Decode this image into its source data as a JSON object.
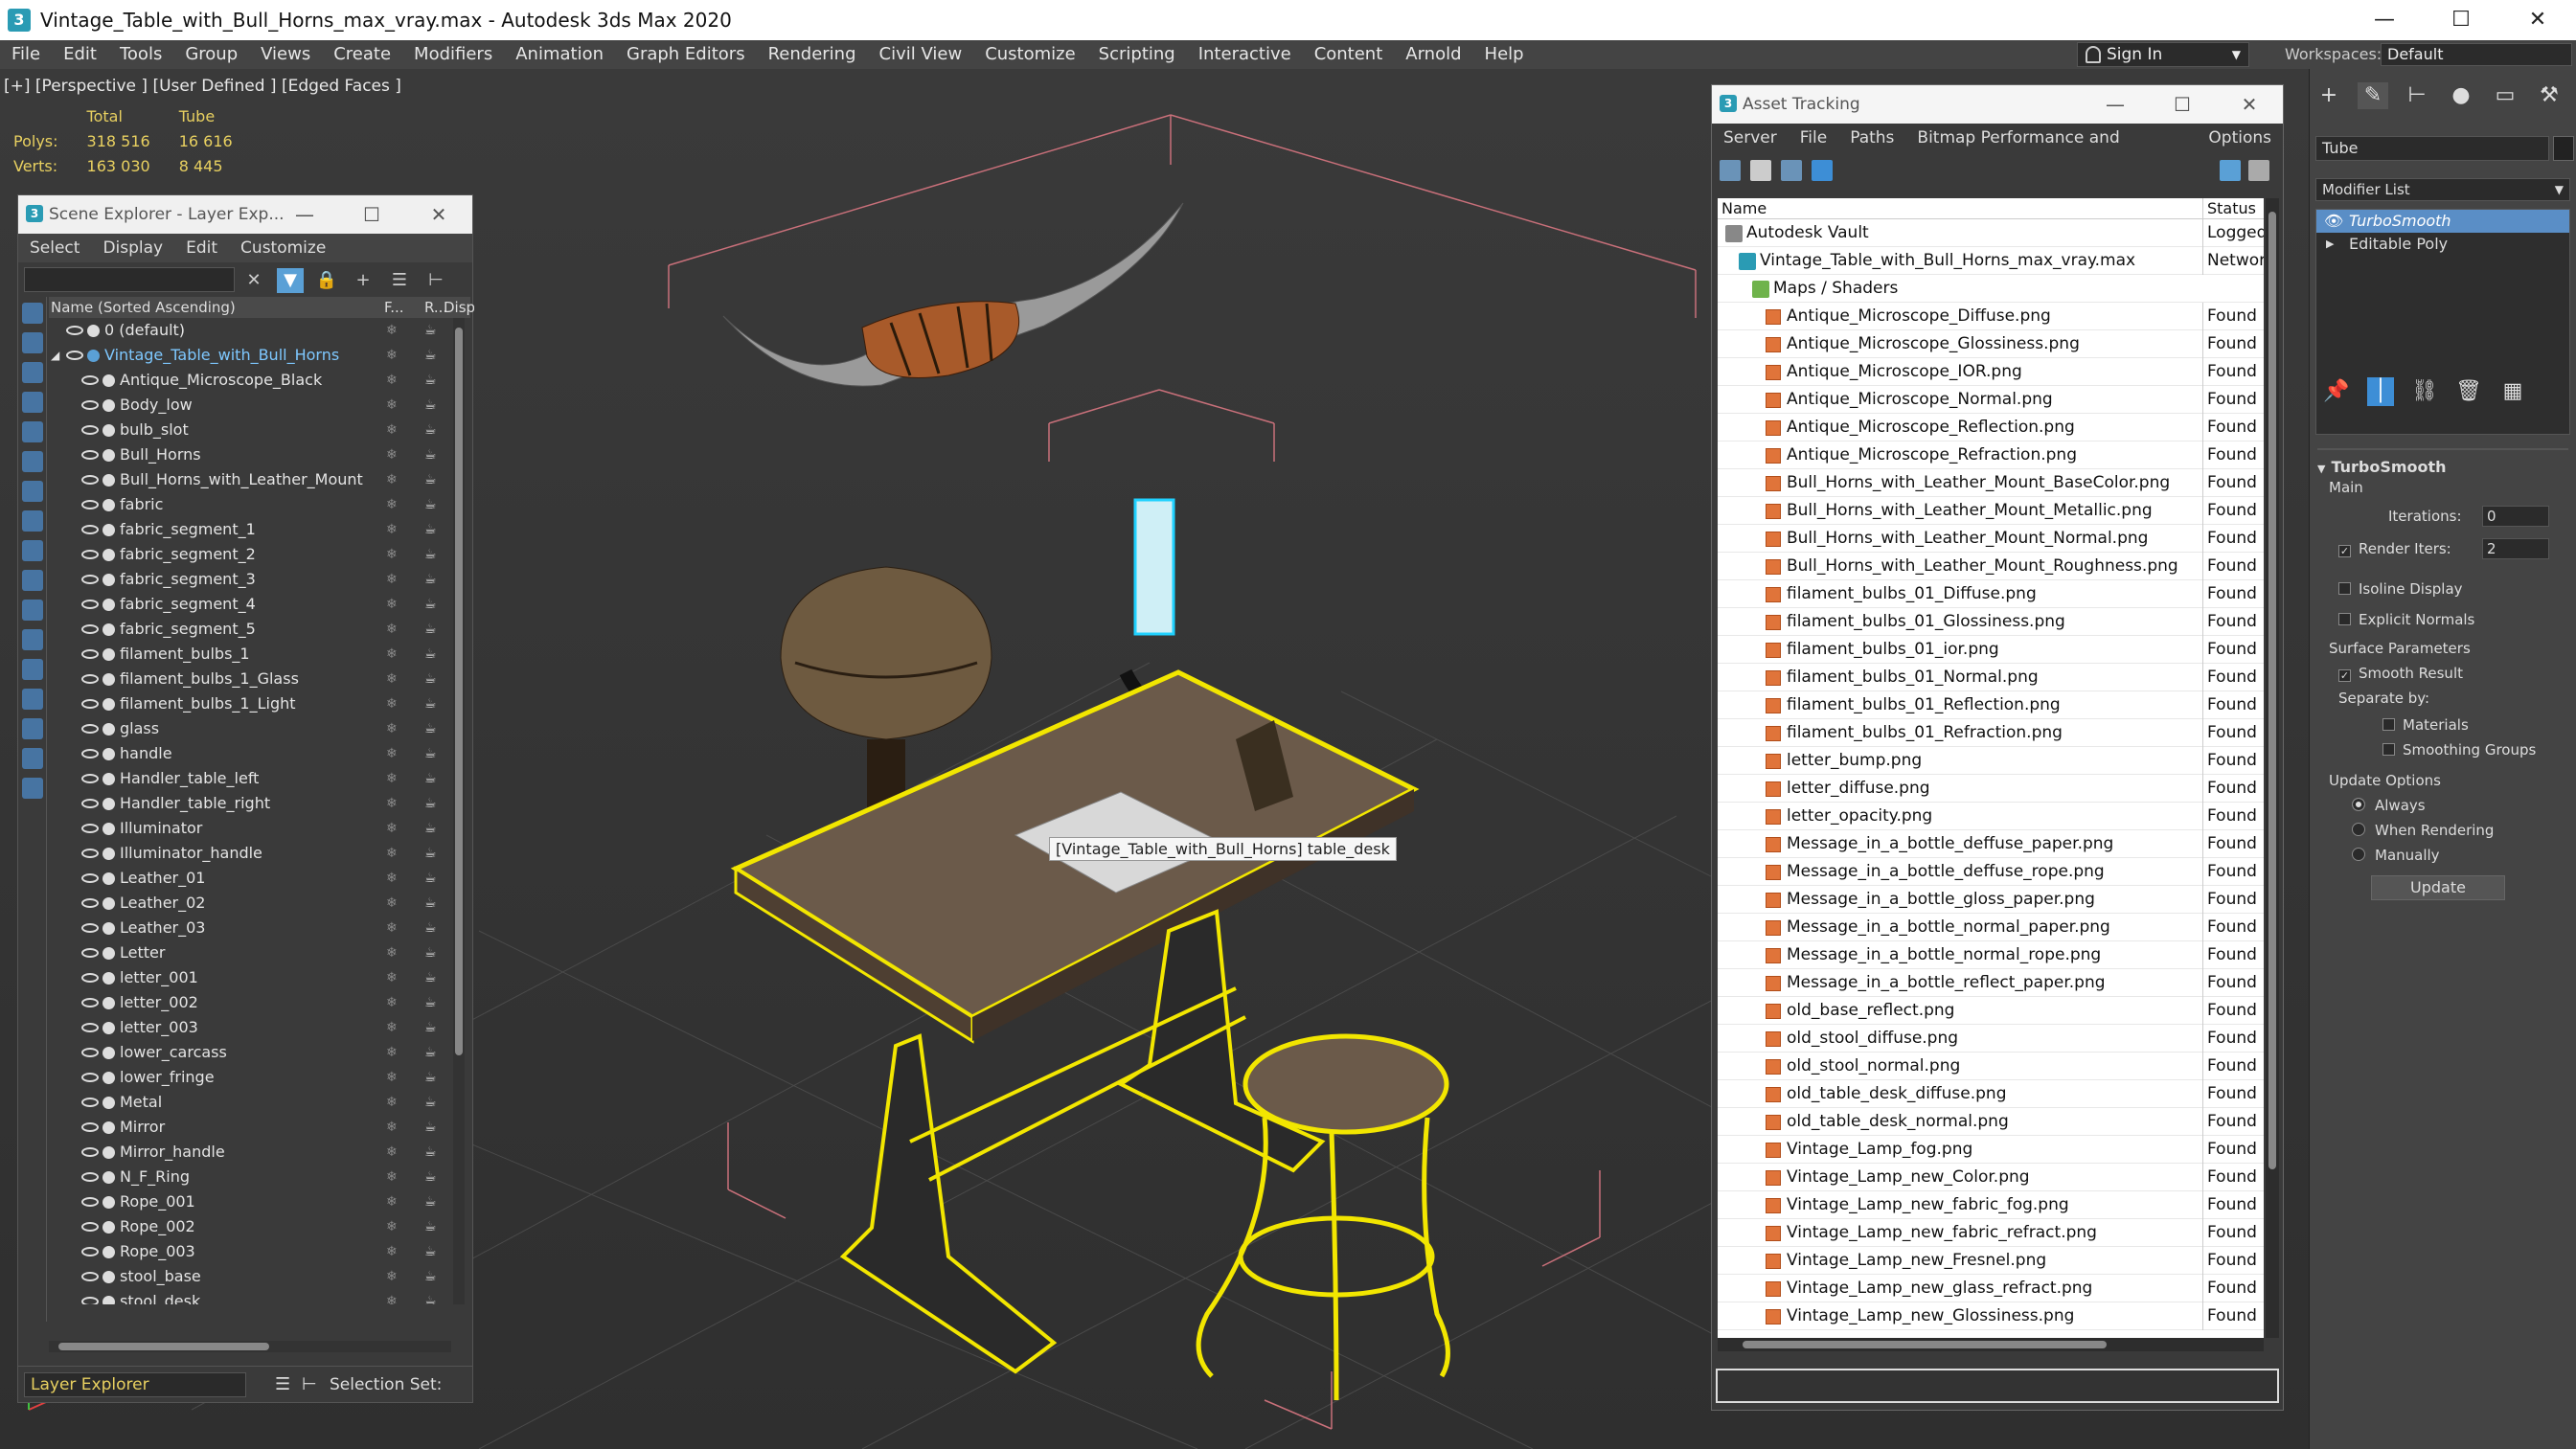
{
  "window": {
    "title": "Vintage_Table_with_Bull_Horns_max_vray.max - Autodesk 3ds Max 2020",
    "app_icon": "3"
  },
  "menu": [
    "File",
    "Edit",
    "Tools",
    "Group",
    "Views",
    "Create",
    "Modifiers",
    "Animation",
    "Graph Editors",
    "Rendering",
    "Civil View",
    "Customize",
    "Scripting",
    "Interactive",
    "Content",
    "Arnold",
    "Help"
  ],
  "account": {
    "sign_in": "Sign In",
    "workspaces_label": "Workspaces:",
    "workspace": "Default"
  },
  "viewport": {
    "label": "[+] [Perspective ] [User Defined ] [Edged Faces ]",
    "stats": {
      "col_total": "Total",
      "col_tube": "Tube",
      "polys_label": "Polys:",
      "polys_total": "318 516",
      "polys_tube": "16 616",
      "verts_label": "Verts:",
      "verts_total": "163 030",
      "verts_tube": "8 445"
    },
    "tooltip": "[Vintage_Table_with_Bull_Horns] table_desk"
  },
  "scene_explorer": {
    "title": "Scene Explorer - Layer Exp...",
    "menu": [
      "Select",
      "Display",
      "Edit",
      "Customize"
    ],
    "columns": {
      "name": "Name (Sorted Ascending)",
      "f": "F...",
      "r": "R...",
      "d": "Displa"
    },
    "rows": [
      {
        "name": "0 (default)",
        "level": 0
      },
      {
        "name": "Vintage_Table_with_Bull_Horns",
        "level": 0,
        "selected": true
      },
      {
        "name": "Antique_Microscope_Black",
        "level": 1
      },
      {
        "name": "Body_low",
        "level": 1
      },
      {
        "name": "bulb_slot",
        "level": 1
      },
      {
        "name": "Bull_Horns",
        "level": 1
      },
      {
        "name": "Bull_Horns_with_Leather_Mount",
        "level": 1
      },
      {
        "name": "fabric",
        "level": 1
      },
      {
        "name": "fabric_segment_1",
        "level": 1
      },
      {
        "name": "fabric_segment_2",
        "level": 1
      },
      {
        "name": "fabric_segment_3",
        "level": 1
      },
      {
        "name": "fabric_segment_4",
        "level": 1
      },
      {
        "name": "fabric_segment_5",
        "level": 1
      },
      {
        "name": "filament_bulbs_1",
        "level": 1
      },
      {
        "name": "filament_bulbs_1_Glass",
        "level": 1
      },
      {
        "name": "filament_bulbs_1_Light",
        "level": 1
      },
      {
        "name": "glass",
        "level": 1
      },
      {
        "name": "handle",
        "level": 1
      },
      {
        "name": "Handler_table_left",
        "level": 1
      },
      {
        "name": "Handler_table_right",
        "level": 1
      },
      {
        "name": "Illuminator",
        "level": 1
      },
      {
        "name": "Illuminator_handle",
        "level": 1
      },
      {
        "name": "Leather_01",
        "level": 1
      },
      {
        "name": "Leather_02",
        "level": 1
      },
      {
        "name": "Leather_03",
        "level": 1
      },
      {
        "name": "Letter",
        "level": 1
      },
      {
        "name": "letter_001",
        "level": 1
      },
      {
        "name": "letter_002",
        "level": 1
      },
      {
        "name": "letter_003",
        "level": 1
      },
      {
        "name": "lower_carcass",
        "level": 1
      },
      {
        "name": "lower_fringe",
        "level": 1
      },
      {
        "name": "Metal",
        "level": 1
      },
      {
        "name": "Mirror",
        "level": 1
      },
      {
        "name": "Mirror_handle",
        "level": 1
      },
      {
        "name": "N_F_Ring",
        "level": 1
      },
      {
        "name": "Rope_001",
        "level": 1
      },
      {
        "name": "Rope_002",
        "level": 1
      },
      {
        "name": "Rope_003",
        "level": 1
      },
      {
        "name": "stool_base",
        "level": 1
      },
      {
        "name": "stool_desk",
        "level": 1
      }
    ],
    "footer": {
      "layer_explorer": "Layer Explorer",
      "selection_set": "Selection Set:"
    }
  },
  "asset_tracking": {
    "title": "Asset Tracking",
    "menu": [
      "Server",
      "File",
      "Paths",
      "Bitmap Performance and Memory",
      "Options"
    ],
    "columns": {
      "name": "Name",
      "status": "Status"
    },
    "rows": [
      {
        "name": "Autodesk Vault",
        "status": "Logged",
        "kind": "vault",
        "indent": 0
      },
      {
        "name": "Vintage_Table_with_Bull_Horns_max_vray.max",
        "status": "Networ",
        "kind": "max",
        "indent": 1
      },
      {
        "name": "Maps / Shaders",
        "status": "",
        "kind": "folder",
        "indent": 2
      },
      {
        "name": "Antique_Microscope_Diffuse.png",
        "status": "Found",
        "kind": "file",
        "indent": 3
      },
      {
        "name": "Antique_Microscope_Glossiness.png",
        "status": "Found",
        "kind": "file",
        "indent": 3
      },
      {
        "name": "Antique_Microscope_IOR.png",
        "status": "Found",
        "kind": "file",
        "indent": 3
      },
      {
        "name": "Antique_Microscope_Normal.png",
        "status": "Found",
        "kind": "file",
        "indent": 3
      },
      {
        "name": "Antique_Microscope_Reflection.png",
        "status": "Found",
        "kind": "file",
        "indent": 3
      },
      {
        "name": "Antique_Microscope_Refraction.png",
        "status": "Found",
        "kind": "file",
        "indent": 3
      },
      {
        "name": "Bull_Horns_with_Leather_Mount_BaseColor.png",
        "status": "Found",
        "kind": "file",
        "indent": 3
      },
      {
        "name": "Bull_Horns_with_Leather_Mount_Metallic.png",
        "status": "Found",
        "kind": "file",
        "indent": 3
      },
      {
        "name": "Bull_Horns_with_Leather_Mount_Normal.png",
        "status": "Found",
        "kind": "file",
        "indent": 3
      },
      {
        "name": "Bull_Horns_with_Leather_Mount_Roughness.png",
        "status": "Found",
        "kind": "file",
        "indent": 3
      },
      {
        "name": "filament_bulbs_01_Diffuse.png",
        "status": "Found",
        "kind": "file",
        "indent": 3
      },
      {
        "name": "filament_bulbs_01_Glossiness.png",
        "status": "Found",
        "kind": "file",
        "indent": 3
      },
      {
        "name": "filament_bulbs_01_ior.png",
        "status": "Found",
        "kind": "file",
        "indent": 3
      },
      {
        "name": "filament_bulbs_01_Normal.png",
        "status": "Found",
        "kind": "file",
        "indent": 3
      },
      {
        "name": "filament_bulbs_01_Reflection.png",
        "status": "Found",
        "kind": "file",
        "indent": 3
      },
      {
        "name": "filament_bulbs_01_Refraction.png",
        "status": "Found",
        "kind": "file",
        "indent": 3
      },
      {
        "name": "letter_bump.png",
        "status": "Found",
        "kind": "file",
        "indent": 3
      },
      {
        "name": "letter_diffuse.png",
        "status": "Found",
        "kind": "file",
        "indent": 3
      },
      {
        "name": "letter_opacity.png",
        "status": "Found",
        "kind": "file",
        "indent": 3
      },
      {
        "name": "Message_in_a_bottle_deffuse_paper.png",
        "status": "Found",
        "kind": "file",
        "indent": 3
      },
      {
        "name": "Message_in_a_bottle_deffuse_rope.png",
        "status": "Found",
        "kind": "file",
        "indent": 3
      },
      {
        "name": "Message_in_a_bottle_gloss_paper.png",
        "status": "Found",
        "kind": "file",
        "indent": 3
      },
      {
        "name": "Message_in_a_bottle_normal_paper.png",
        "status": "Found",
        "kind": "file",
        "indent": 3
      },
      {
        "name": "Message_in_a_bottle_normal_rope.png",
        "status": "Found",
        "kind": "file",
        "indent": 3
      },
      {
        "name": "Message_in_a_bottle_reflect_paper.png",
        "status": "Found",
        "kind": "file",
        "indent": 3
      },
      {
        "name": "old_base_reflect.png",
        "status": "Found",
        "kind": "file",
        "indent": 3
      },
      {
        "name": "old_stool_diffuse.png",
        "status": "Found",
        "kind": "file",
        "indent": 3
      },
      {
        "name": "old_stool_normal.png",
        "status": "Found",
        "kind": "file",
        "indent": 3
      },
      {
        "name": "old_table_desk_diffuse.png",
        "status": "Found",
        "kind": "file",
        "indent": 3
      },
      {
        "name": "old_table_desk_normal.png",
        "status": "Found",
        "kind": "file",
        "indent": 3
      },
      {
        "name": "Vintage_Lamp_fog.png",
        "status": "Found",
        "kind": "file",
        "indent": 3
      },
      {
        "name": "Vintage_Lamp_new_Color.png",
        "status": "Found",
        "kind": "file",
        "indent": 3
      },
      {
        "name": "Vintage_Lamp_new_fabric_fog.png",
        "status": "Found",
        "kind": "file",
        "indent": 3
      },
      {
        "name": "Vintage_Lamp_new_fabric_refract.png",
        "status": "Found",
        "kind": "file",
        "indent": 3
      },
      {
        "name": "Vintage_Lamp_new_Fresnel.png",
        "status": "Found",
        "kind": "file",
        "indent": 3
      },
      {
        "name": "Vintage_Lamp_new_glass_refract.png",
        "status": "Found",
        "kind": "file",
        "indent": 3
      },
      {
        "name": "Vintage_Lamp_new_Glossiness.png",
        "status": "Found",
        "kind": "file",
        "indent": 3
      }
    ]
  },
  "command_panel": {
    "object_name": "Tube",
    "modifier_list": "Modifier List",
    "stack": [
      "TurboSmooth",
      "Editable Poly"
    ],
    "turbosmooth": {
      "title": "TurboSmooth",
      "main": "Main",
      "iterations_label": "Iterations:",
      "iterations": "0",
      "render_iters_label": "Render Iters:",
      "render_iters": "2",
      "isoline": "Isoline Display",
      "explicit": "Explicit Normals",
      "surface": "Surface Parameters",
      "smooth_result": "Smooth Result",
      "separate_by": "Separate by:",
      "materials": "Materials",
      "smoothing_groups": "Smoothing Groups",
      "update_options": "Update Options",
      "always": "Always",
      "when_rendering": "When Rendering",
      "manually": "Manually",
      "update": "Update"
    }
  },
  "colors": {
    "selection": "#f2e600",
    "accent": "#5a8ec6",
    "stats": "#e8d060"
  }
}
